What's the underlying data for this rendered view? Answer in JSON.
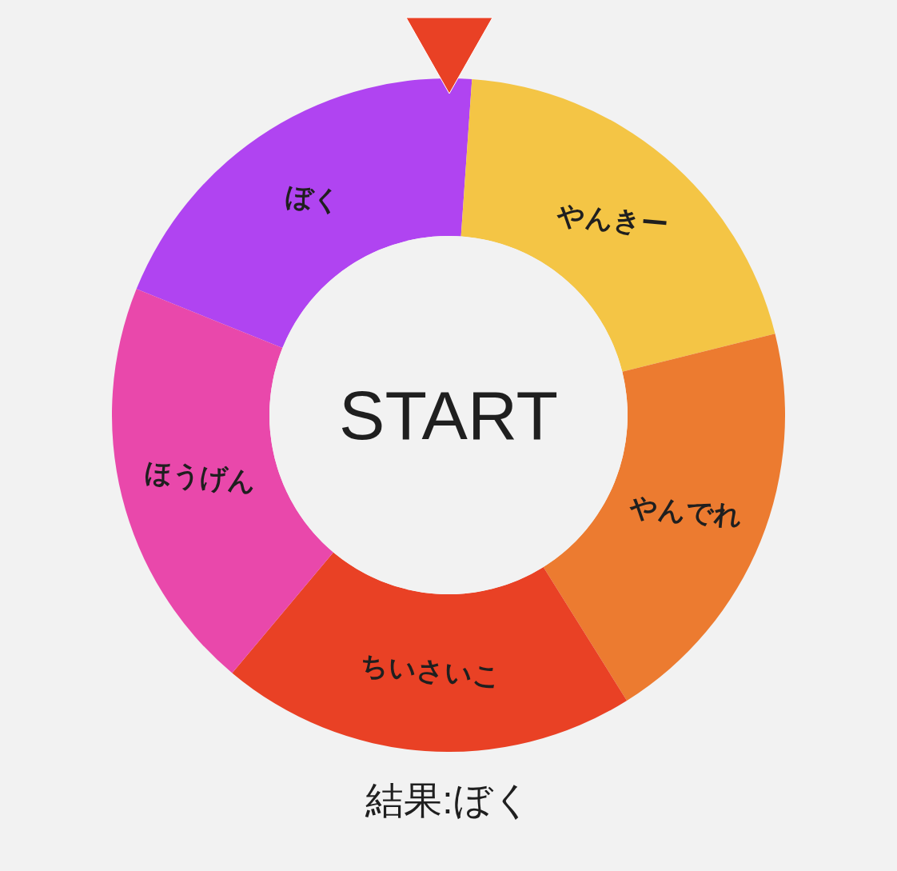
{
  "pointer": {
    "color": "#e94125"
  },
  "wheel": {
    "segments": [
      {
        "label": "ぼく",
        "color": "#b044f1"
      },
      {
        "label": "やんきー",
        "color": "#f4c545"
      },
      {
        "label": "やんでれ",
        "color": "#ec7b30"
      },
      {
        "label": "ちいさいこ",
        "color": "#e94125"
      },
      {
        "label": "ほうげん",
        "color": "#e948ab"
      }
    ],
    "center_button": {
      "label": "START"
    }
  },
  "result": {
    "text": "結果:ぼく"
  }
}
